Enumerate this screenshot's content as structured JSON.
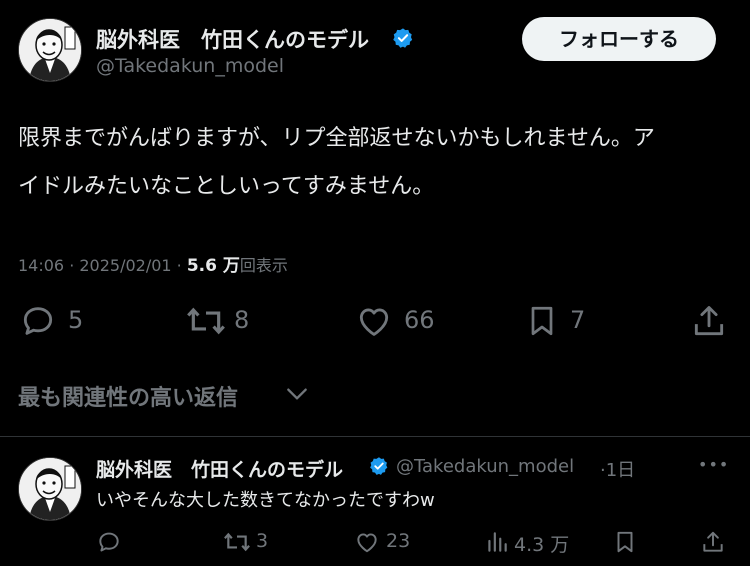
{
  "tweet": {
    "author_name": "脳外科医　竹田くんのモデル",
    "handle": "@Takedakun_model",
    "follow_label": "フォローする",
    "text_line1": "限界までがんばりますが、リプ全部返せないかもしれません。ア",
    "text_line2": "イドルみたいなことしいってすみません。",
    "time": "14:06 · 2025/02/01 · ",
    "views_count": "5.6 万",
    "views_label": "回表示",
    "replies": "5",
    "retweets": "8",
    "likes": "66",
    "bookmarks": "7"
  },
  "relevant_label": "最も関連性の高い返信",
  "reply": {
    "author_name": "脳外科医　竹田くんのモデル",
    "handle": "@Takedakun_model",
    "age": "·1日",
    "more": "•••",
    "text": "いやそんな大した数きてなかったですわw",
    "retweets": "3",
    "likes": "23",
    "views": "4.3 万"
  },
  "colors": {
    "background": "#000000",
    "verified": "#1d9bf0",
    "secondary_text": "#71767b"
  },
  "icons": [
    "verified-icon",
    "reply-icon",
    "retweet-icon",
    "like-icon",
    "bookmark-icon",
    "share-icon",
    "chevron-down-icon",
    "views-icon",
    "more-icon"
  ]
}
